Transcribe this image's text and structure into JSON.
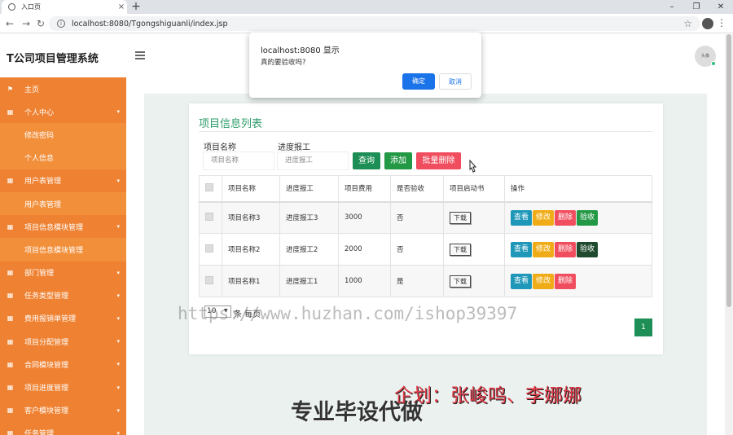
{
  "browser": {
    "tab_title": "入口页",
    "url": "localhost:8080/Tgongshiguanli/index.jsp"
  },
  "header": {
    "app_title": "T公司项目管理系统",
    "avatar_text": "头像"
  },
  "sidebar": {
    "items": [
      {
        "label": "主页",
        "icon": "flag-icon",
        "sub": false,
        "caret": false
      },
      {
        "label": "个人中心",
        "icon": "grid-icon",
        "sub": false,
        "caret": true
      },
      {
        "label": "修改密码",
        "sub": true
      },
      {
        "label": "个人信息",
        "sub": true
      },
      {
        "label": "用户表管理",
        "icon": "grid-icon",
        "sub": false,
        "caret": true
      },
      {
        "label": "用户表管理",
        "sub": true
      },
      {
        "label": "项目信息模块管理",
        "icon": "grid-icon",
        "sub": false,
        "caret": true
      },
      {
        "label": "项目信息模块管理",
        "sub": true
      },
      {
        "label": "部门管理",
        "icon": "grid-icon",
        "sub": false,
        "caret": true
      },
      {
        "label": "任务类型管理",
        "icon": "grid-icon",
        "sub": false,
        "caret": true
      },
      {
        "label": "费用报销单管理",
        "icon": "grid-icon",
        "sub": false,
        "caret": true
      },
      {
        "label": "项目分配管理",
        "icon": "grid-icon",
        "sub": false,
        "caret": true
      },
      {
        "label": "合同模块管理",
        "icon": "grid-icon",
        "sub": false,
        "caret": true
      },
      {
        "label": "项目进度管理",
        "icon": "grid-icon",
        "sub": false,
        "caret": true
      },
      {
        "label": "客户模块管理",
        "icon": "grid-icon",
        "sub": false,
        "caret": true
      },
      {
        "label": "任务管理",
        "icon": "grid-icon",
        "sub": false,
        "caret": true
      }
    ]
  },
  "main": {
    "card_title": "项目信息列表",
    "search": {
      "name_label": "项目名称",
      "name_placeholder": "项目名称",
      "progress_label": "进度报工",
      "progress_placeholder": "进度报工",
      "query_button": "查询",
      "add_button": "添加",
      "batch_delete_button": "批量删除"
    },
    "table": {
      "headers": [
        "项目名称",
        "进度报工",
        "项目费用",
        "是否验收",
        "项目启动书",
        "操作"
      ],
      "download_label": "下载",
      "op_labels": {
        "view": "查看",
        "edit": "修改",
        "delete": "删除",
        "accept": "验收"
      },
      "rows": [
        {
          "name": "项目名称3",
          "progress": "进度报工3",
          "cost": "3000",
          "accepted": "否"
        },
        {
          "name": "项目名称2",
          "progress": "进度报工2",
          "cost": "2000",
          "accepted": "否"
        },
        {
          "name": "项目名称1",
          "progress": "进度报工1",
          "cost": "1000",
          "accepted": "是"
        }
      ]
    },
    "pagination": {
      "page_size": "10",
      "per_page_label": "条 每页",
      "current_page": "1"
    }
  },
  "dialog": {
    "title": "localhost:8080 显示",
    "message": "真的要验收吗?",
    "ok_label": "确定",
    "cancel_label": "取消"
  },
  "watermarks": {
    "url_text": "https://www.huzhan.com/ishop39397",
    "planner_text": "企划：张峻鸣、李娜娜",
    "slogan_text": "专业毕设代做"
  },
  "colors": {
    "sidebar": "#ef8232",
    "accent_green": "#2e9d6a",
    "danger": "#f04d5e",
    "info": "#1e97b8",
    "warning": "#f0ac16"
  }
}
